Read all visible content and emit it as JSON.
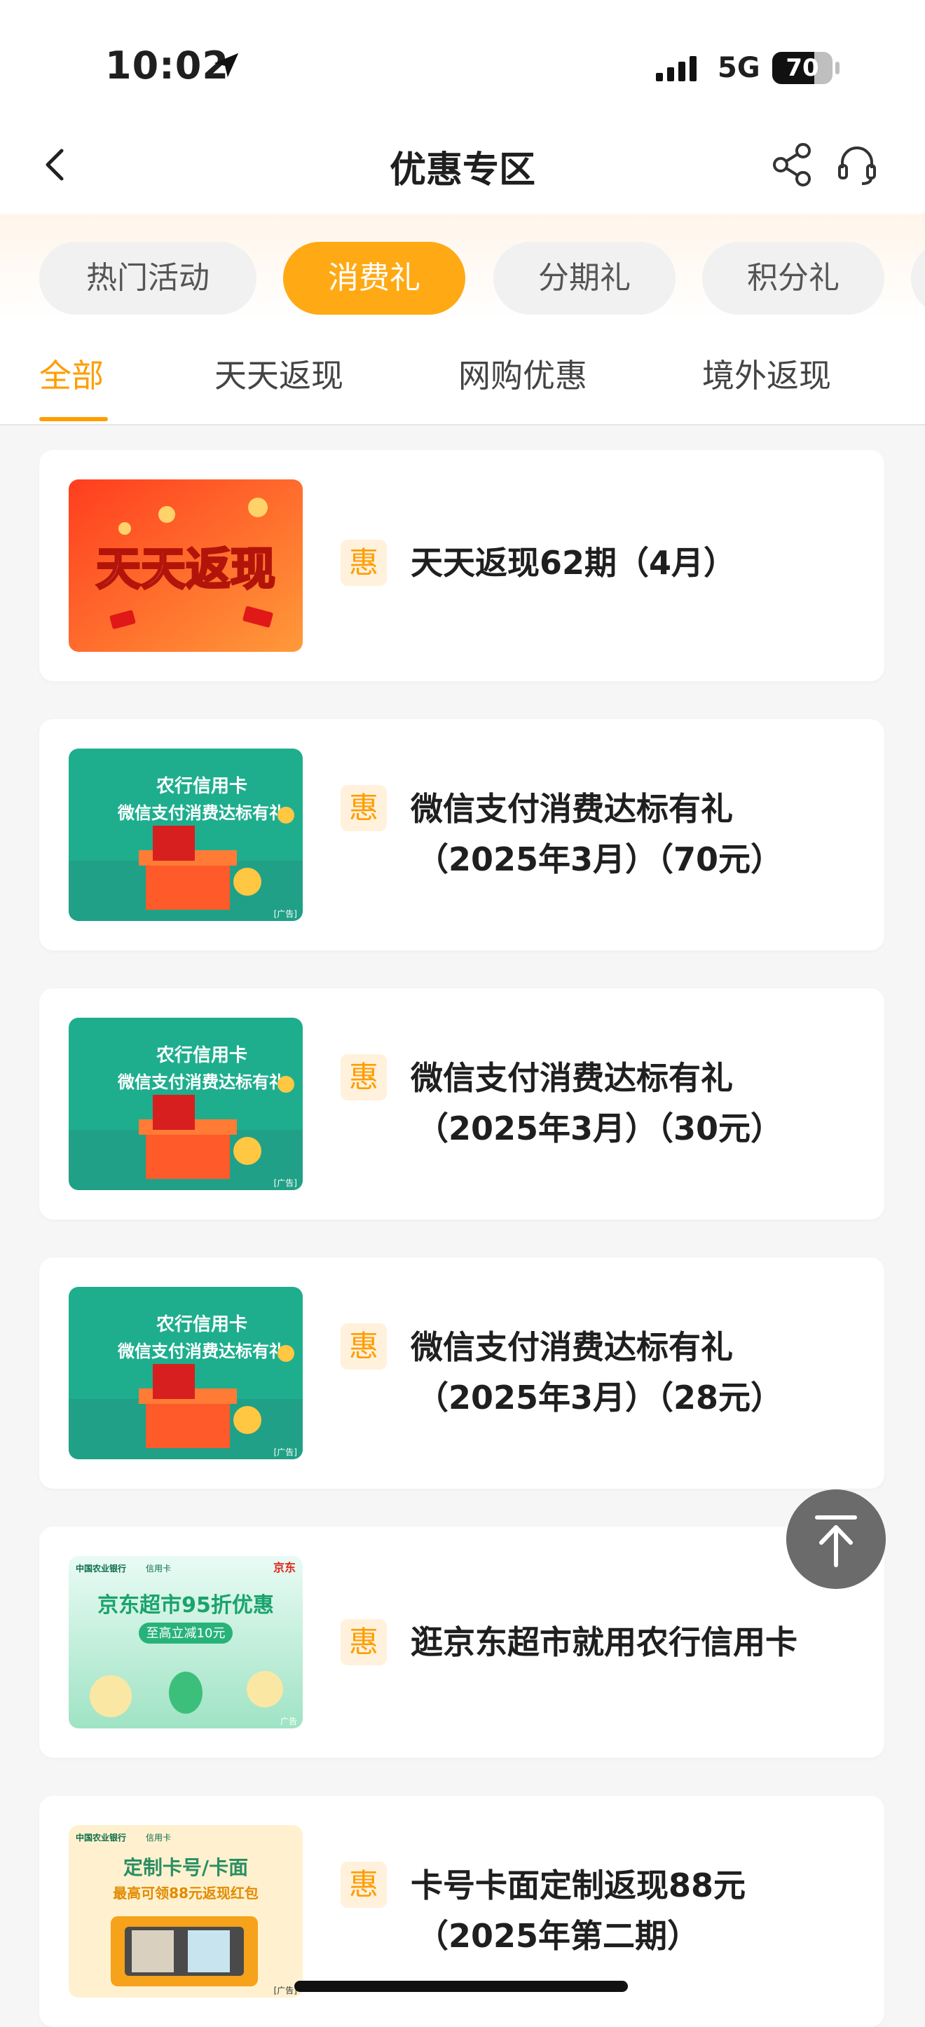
{
  "status_bar": {
    "time": "10:02",
    "network": "5G",
    "battery": 70,
    "battery_text": "70"
  },
  "header": {
    "title": "优惠专区",
    "icons": [
      "back-icon",
      "share-icon",
      "headset-icon"
    ]
  },
  "category_tabs": [
    {
      "label": "热门活动",
      "active": false
    },
    {
      "label": "消费礼",
      "active": true
    },
    {
      "label": "分期礼",
      "active": false
    },
    {
      "label": "积分礼",
      "active": false
    }
  ],
  "sub_tabs": [
    {
      "label": "全部",
      "active": true
    },
    {
      "label": "天天返现",
      "active": false
    },
    {
      "label": "网购优惠",
      "active": false
    },
    {
      "label": "境外返现",
      "active": false
    }
  ],
  "badge_label": "惠",
  "cards": [
    {
      "title_line1": "天天返现62期（4月）",
      "title_line2": "",
      "image": {
        "banner_text": "天天返现"
      }
    },
    {
      "title_line1": "微信支付消费达标有礼",
      "title_line2": "（2025年3月）（70元）",
      "image": {
        "line1": "农行信用卡",
        "line2": "微信支付消费达标有礼",
        "ad": "[广告]"
      }
    },
    {
      "title_line1": "微信支付消费达标有礼",
      "title_line2": "（2025年3月）（30元）",
      "image": {
        "line1": "农行信用卡",
        "line2": "微信支付消费达标有礼",
        "ad": "[广告]"
      }
    },
    {
      "title_line1": "微信支付消费达标有礼",
      "title_line2": "（2025年3月）（28元）",
      "image": {
        "line1": "农行信用卡",
        "line2": "微信支付消费达标有礼",
        "ad": "[广告]"
      }
    },
    {
      "title_line1": "逛京东超市就用农行信用卡",
      "title_line2": "",
      "image": {
        "bank": "中国农业银行",
        "card": "信用卡",
        "partner": "京东",
        "line1": "京东超市95折优惠",
        "line2": "至高立减10元",
        "ad": "广告"
      }
    },
    {
      "title_line1": "卡号卡面定制返现88元",
      "title_line2": "（2025年第二期）",
      "image": {
        "bank": "中国农业银行",
        "card": "信用卡",
        "line1": "定制卡号/卡面",
        "line2": "最高可领88元返现红包",
        "ad": "[广告]"
      }
    }
  ],
  "colors": {
    "accent": "#ffa914",
    "accent_text": "#ff9d00",
    "badge_bg": "#fff1dc",
    "page_bg": "#f6f6f6"
  }
}
